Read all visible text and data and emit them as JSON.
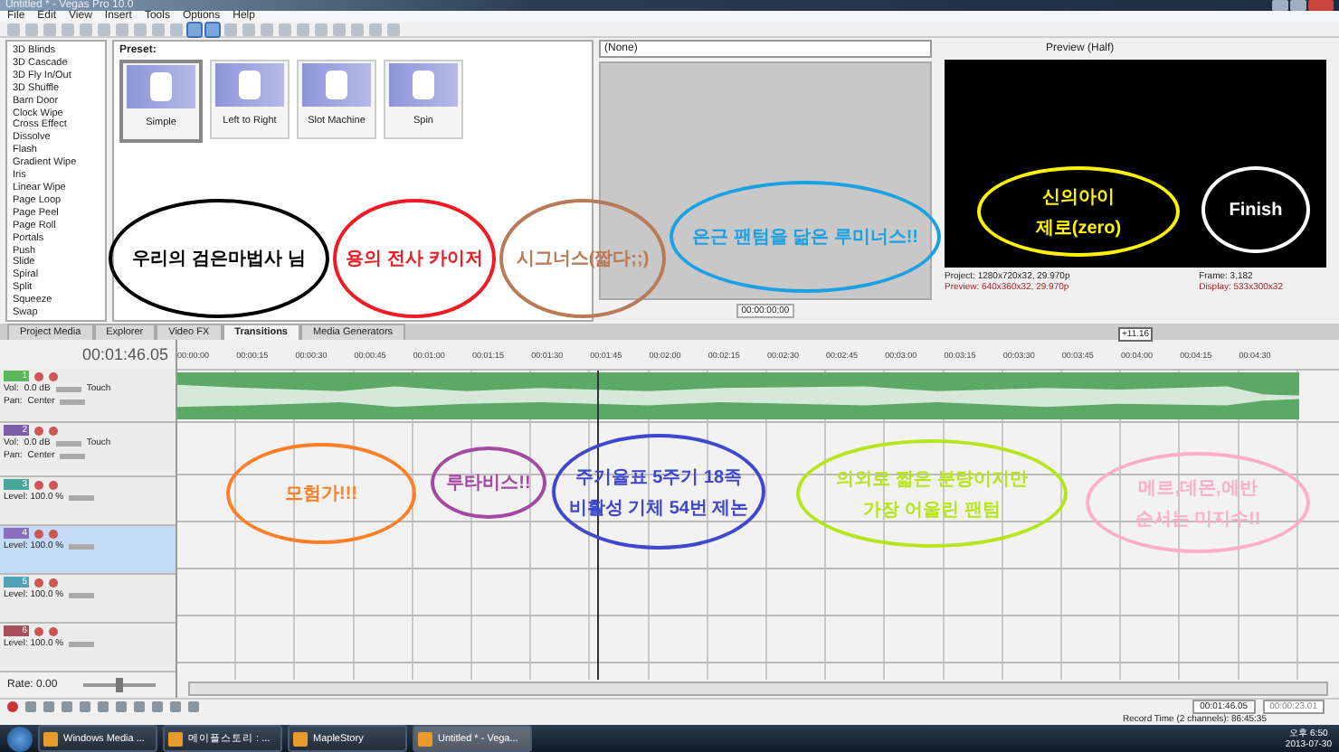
{
  "window": {
    "title": "Untitled * - Vegas Pro 10.0"
  },
  "menu": [
    "File",
    "Edit",
    "View",
    "Insert",
    "Tools",
    "Options",
    "Help"
  ],
  "transitions_list": {
    "items": [
      "3D Blinds",
      "3D Cascade",
      "3D Fly In/Out",
      "3D Shuffle",
      "Barn Door",
      "Clock Wipe",
      "Cross Effect",
      "Dissolve",
      "Flash",
      "Gradient Wipe",
      "Iris",
      "Linear Wipe",
      "Page Loop",
      "Page Peel",
      "Page Roll",
      "Portals",
      "Push",
      "Slide",
      "Spiral",
      "Split",
      "Squeeze",
      "Swap"
    ]
  },
  "presets": {
    "heading": "Preset:",
    "items": [
      {
        "label": "Simple",
        "selected": true
      },
      {
        "label": "Left to Right",
        "selected": false
      },
      {
        "label": "Slot Machine",
        "selected": false
      },
      {
        "label": "Spin",
        "selected": false
      }
    ]
  },
  "trimmer": {
    "source": "(None)",
    "timecode": "00:00:00;00"
  },
  "preview": {
    "quality": "Preview (Half)",
    "project": "Project: 1280x720x32, 29.970p",
    "preview_info": "Preview: 640x360x32, 29.970p",
    "frame": "Frame: 3,182",
    "display": "Display: 533x300x32",
    "length_badge": "+11.16"
  },
  "tabs": [
    {
      "label": "Project Media",
      "selected": false
    },
    {
      "label": "Explorer",
      "selected": false
    },
    {
      "label": "Video FX",
      "selected": false
    },
    {
      "label": "Transitions",
      "selected": true
    },
    {
      "label": "Media Generators",
      "selected": false
    }
  ],
  "timeline": {
    "timecode": "00:01:46.05",
    "ruler": [
      "00:00:00",
      "00:00:15",
      "00:00:30",
      "00:00:45",
      "00:01:00",
      "00:01:15",
      "00:01:30",
      "00:01:45",
      "00:02:00",
      "00:02:15",
      "00:02:30",
      "00:02:45",
      "00:03:00",
      "00:03:15",
      "00:03:30",
      "00:03:45",
      "00:04:00",
      "00:04:15",
      "00:04:30"
    ],
    "tracks": [
      {
        "kind": "audio",
        "number": "1",
        "color": "#5cb85c",
        "selected": false,
        "vol": "0.0 dB",
        "mode": "Touch",
        "pan": "Center",
        "vol_label": "Vol:",
        "pan_label": "Pan:"
      },
      {
        "kind": "audio",
        "number": "2",
        "color": "#7b5ea7",
        "selected": false,
        "vol": "0.0 dB",
        "mode": "Touch",
        "pan": "Center",
        "vol_label": "Vol:",
        "pan_label": "Pan:"
      },
      {
        "kind": "video",
        "number": "3",
        "color": "#4aa89a",
        "selected": false,
        "level": "Level: 100.0 %"
      },
      {
        "kind": "video",
        "number": "4",
        "color": "#8a6fc0",
        "selected": true,
        "level": "Level: 100.0 %"
      },
      {
        "kind": "video",
        "number": "5",
        "color": "#52a3b8",
        "selected": false,
        "level": "Level: 100.0 %"
      },
      {
        "kind": "video",
        "number": "6",
        "color": "#a8505a",
        "selected": false,
        "level": "Level: 100.0 %"
      }
    ],
    "rate": "Rate: 0.00",
    "rate_slider": {
      "level": 0.5
    },
    "cursor_time": "00:01:46.05",
    "selection_length": "00:00:23.01"
  },
  "status_bar": "Record Time (2 channels): 86:45:35",
  "bubbles": [
    {
      "lines": [
        "우리의 검은마법사 님"
      ],
      "color": "#000000"
    },
    {
      "lines": [
        "용의 전사 카이저"
      ],
      "color": "#ee1c24"
    },
    {
      "lines": [
        "시그너스(짧다;;)"
      ],
      "color": "#b97a57"
    },
    {
      "lines": [
        "은근 팬텀을 닮은 루미너스!!"
      ],
      "color": "#1ba1e2"
    },
    {
      "lines": [
        "신의아이",
        "제로(zero)"
      ],
      "color": "#fff200"
    },
    {
      "lines": [
        "Finish"
      ],
      "color": "#ffffff"
    },
    {
      "lines": [
        "모험가!!!"
      ],
      "color": "#ff7f27"
    },
    {
      "lines": [
        "루타비스!!"
      ],
      "color": "#a349a4"
    },
    {
      "lines": [
        "주기율표 5주기 18족",
        "비활성 기체 54번 제논"
      ],
      "color": "#3f48cc"
    },
    {
      "lines": [
        "의외로 짧은 분량이지만",
        "가장 어울린 팬텀"
      ],
      "color": "#b5e61d"
    },
    {
      "lines": [
        "메르,데몬,에반",
        "순서는 미지수!!"
      ],
      "color": "#ffaec9"
    }
  ],
  "taskbar": {
    "items": [
      {
        "label": "Windows Media ...",
        "active": false
      },
      {
        "label": "메이플스토리 : ...",
        "active": false
      },
      {
        "label": "MapleStory",
        "active": false
      },
      {
        "label": "Untitled * - Vega...",
        "active": true
      }
    ],
    "time": "오후 6:50",
    "date": "2013-07-30"
  }
}
